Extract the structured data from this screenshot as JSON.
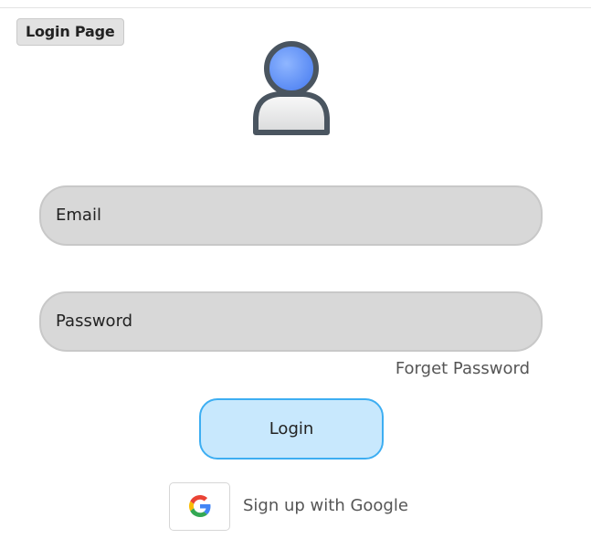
{
  "page": {
    "tag_label": "Login Page"
  },
  "form": {
    "email_label": "Email",
    "password_label": "Password",
    "forgot_label": "Forget Password",
    "login_label": "Login",
    "google_label": "Sign up with Google"
  },
  "icons": {
    "avatar": "user-avatar-icon",
    "google": "google-g-icon"
  },
  "colors": {
    "avatar_head": "#5b8ef5",
    "avatar_outline": "#4a5560",
    "field_fill": "#d8d8d8",
    "login_fill": "#c8e8fd",
    "login_border": "#3daef2"
  }
}
